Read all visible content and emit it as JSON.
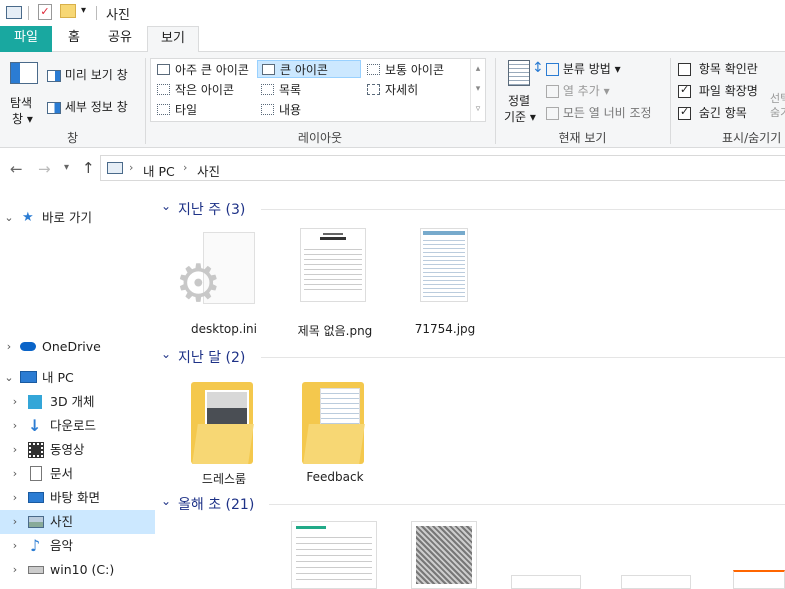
{
  "window": {
    "title": "사진"
  },
  "tabs": {
    "file": "파일",
    "home": "홈",
    "share": "공유",
    "view": "보기"
  },
  "ribbon": {
    "pane_group": {
      "nav_pane": "탐색\n창",
      "nav_pane_line1": "탐색",
      "nav_pane_line2": "창 ▾",
      "preview": "미리 보기 창",
      "details": "세부 정보 창",
      "label": "창"
    },
    "layout_group": {
      "items": [
        "아주 큰 아이콘",
        "큰 아이콘",
        "보통 아이콘",
        "작은 아이콘",
        "목록",
        "자세히",
        "타일",
        "내용"
      ],
      "label": "레이아웃"
    },
    "view_group": {
      "sort_line1": "정렬",
      "sort_line2": "기준 ▾",
      "group_by": "분류 방법 ▾",
      "add_column": "열 추가 ▾",
      "fit_columns": "모든 열 너비 조정",
      "label": "현재 보기"
    },
    "show_group": {
      "item_checkbox": "항목 확인란",
      "extensions": "파일 확장명",
      "hidden": "숨긴 항목",
      "select_partial": "선택",
      "hide_partial": "숨기",
      "label": "표시/숨기기",
      "item_checkbox_on": false,
      "extensions_on": true,
      "hidden_on": true
    }
  },
  "address": {
    "crumbs": [
      "내 PC",
      "사진"
    ]
  },
  "nav": {
    "quick": "바로 가기",
    "onedrive": "OneDrive",
    "thispc": "내 PC",
    "items": [
      "3D 개체",
      "다운로드",
      "동영상",
      "문서",
      "바탕 화면",
      "사진",
      "음악",
      "win10 (C:)"
    ],
    "selected": "사진"
  },
  "groups": [
    {
      "title": "지난 주 (3)",
      "files": [
        "desktop.ini",
        "제목 없음.png",
        "71754.jpg"
      ]
    },
    {
      "title": "지난 달 (2)",
      "files": [
        "드레스룸",
        "Feedback"
      ]
    },
    {
      "title": "올해 초 (21)",
      "files": []
    }
  ]
}
